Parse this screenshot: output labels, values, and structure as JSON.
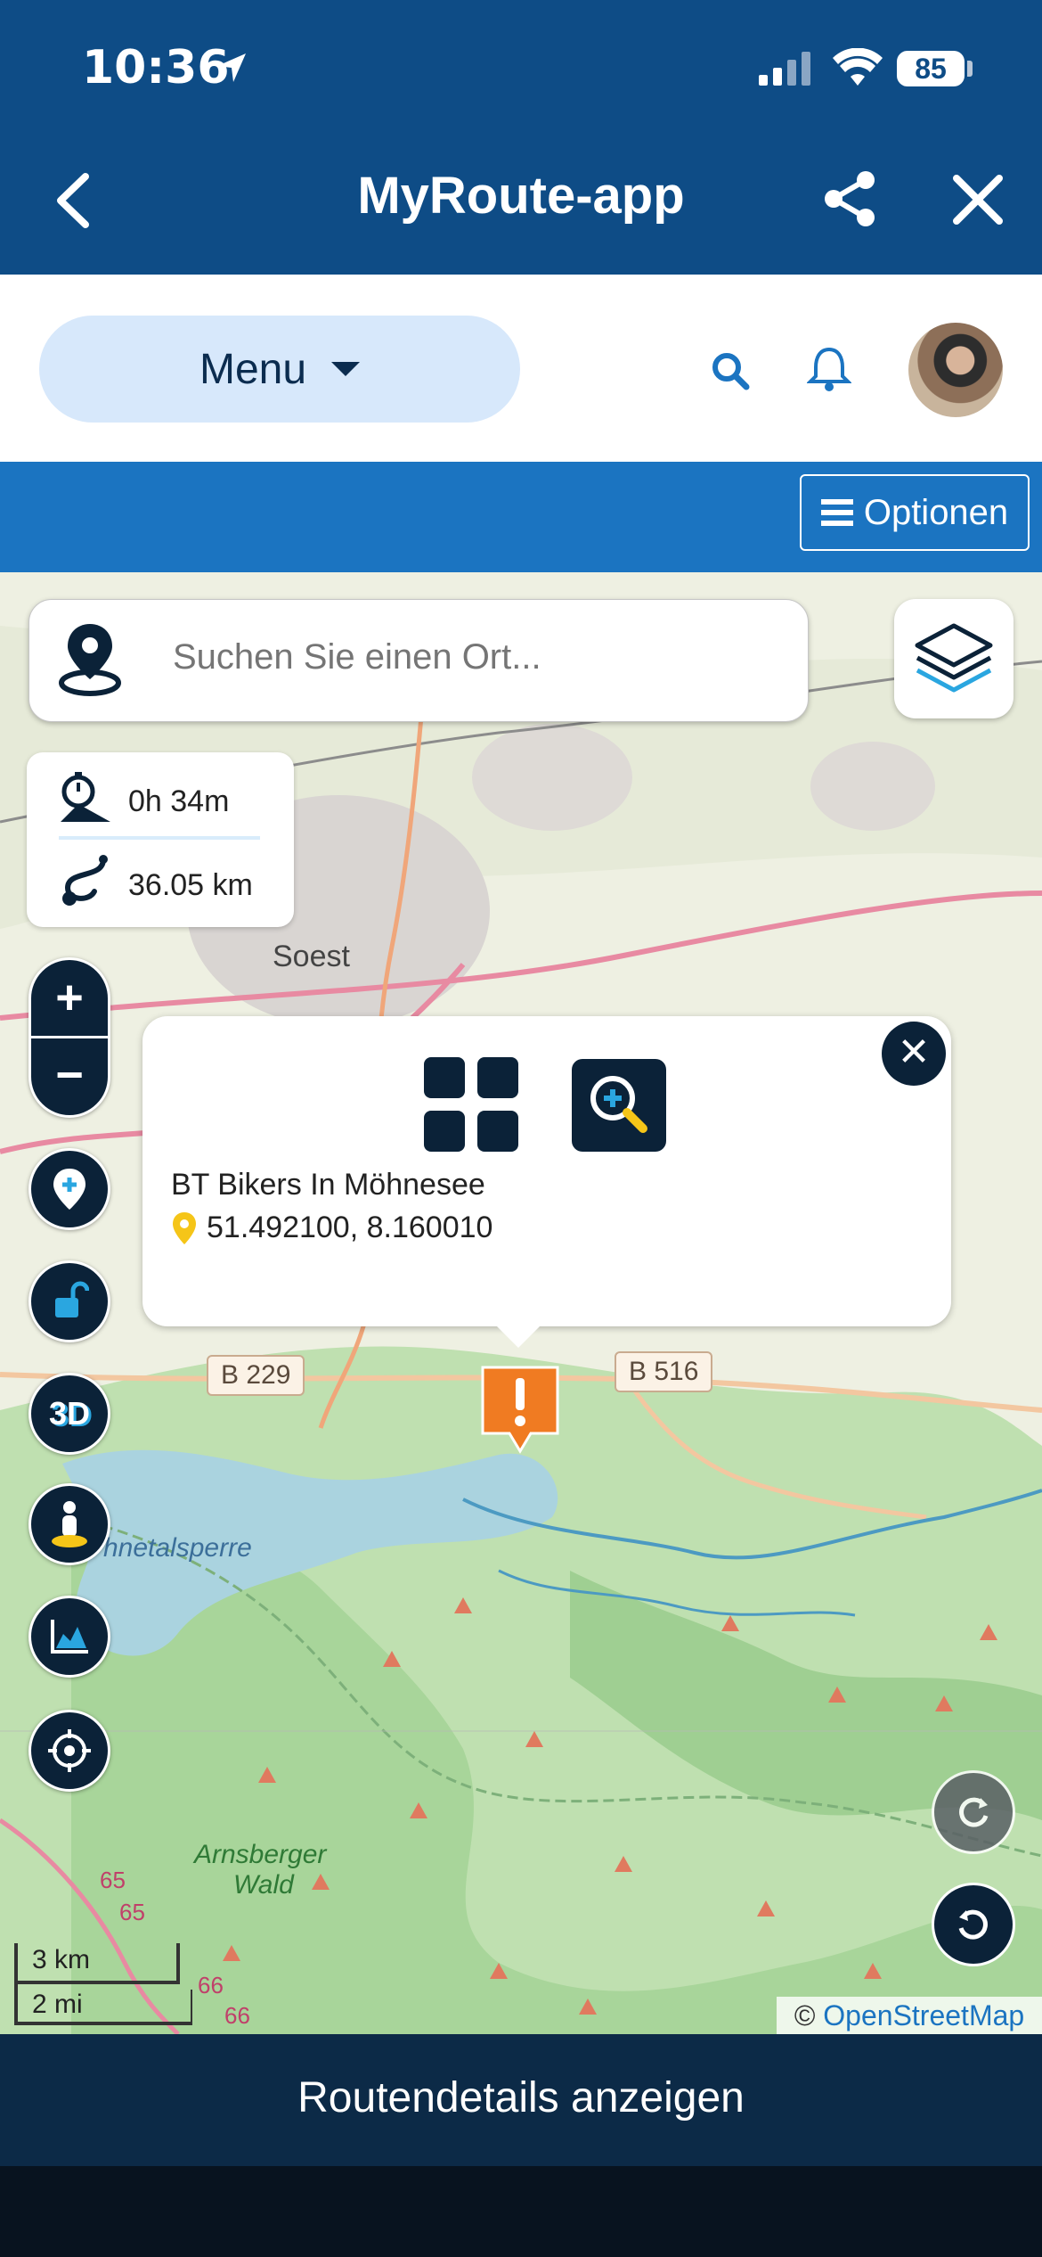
{
  "status_bar": {
    "time": "10:36",
    "battery": "85"
  },
  "header": {
    "title": "MyRoute-app"
  },
  "menu_bar": {
    "menu_label": "Menu"
  },
  "options_bar": {
    "options_label": "Optionen"
  },
  "map": {
    "search_placeholder": "Suchen Sie einen Ort...",
    "stats": {
      "duration": "0h 34m",
      "distance": "36.05 km"
    },
    "labels": {
      "city": "Soest",
      "reservoir": "hnetalsperre",
      "forest_1": "Arnsberger",
      "forest_2": "Wald",
      "road_b229": "B 229",
      "road_b516": "B 516",
      "road_65a": "65",
      "road_65b": "65",
      "road_66a": "66",
      "road_66b": "66"
    },
    "zoom_in": "+",
    "zoom_out": "−",
    "three_d_label": "3D",
    "scale": {
      "metric": "3 km",
      "imperial": "2 mi"
    },
    "attribution_prefix": "©",
    "attribution_link": "OpenStreetMap"
  },
  "popup": {
    "close": "✕",
    "poi_name": "BT Bikers In Möhnesee",
    "coordinates": "51.492100, 8.160010"
  },
  "footer": {
    "button_label": "Routendetails anzeigen"
  },
  "icons": [
    "location-arrow-icon",
    "signal-icon",
    "wifi-icon",
    "back-icon",
    "share-icon",
    "close-icon",
    "search-icon",
    "bell-icon",
    "hamburger-icon",
    "map-pin-icon",
    "layers-icon",
    "stopwatch-icon",
    "route-icon",
    "add-waypoint-icon",
    "lock-icon",
    "street-view-icon",
    "elevation-icon",
    "crosshair-icon",
    "refresh-icon",
    "reset-icon",
    "add-icon",
    "zoom-search-icon",
    "warning-marker-icon"
  ],
  "colors": {
    "header": "#0e4c86",
    "options_bar": "#1b74c1",
    "dark_control": "#0b2238",
    "marker": "#f07b22",
    "footer": "#0c2a47"
  }
}
